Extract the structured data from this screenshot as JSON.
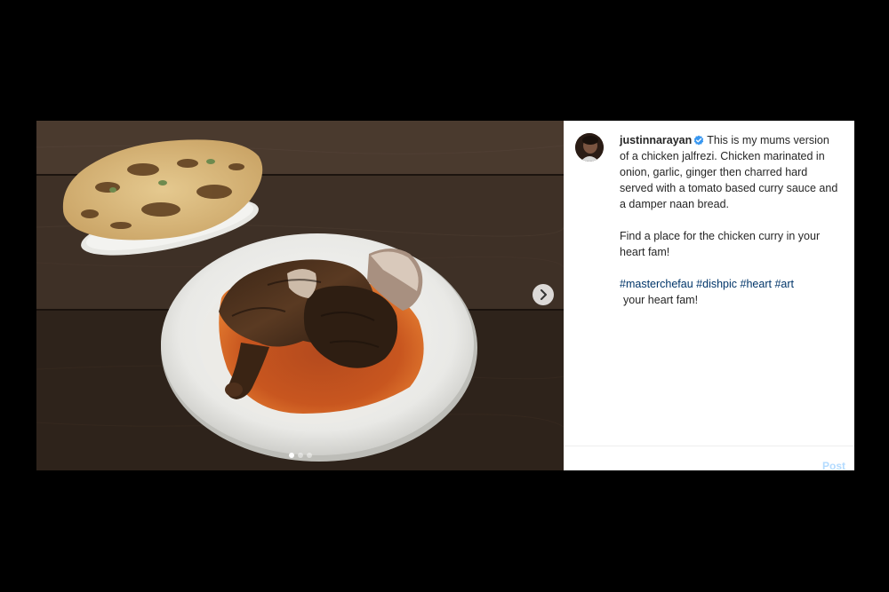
{
  "post": {
    "author": {
      "username": "justinnarayan",
      "verified": true
    },
    "caption": {
      "text": "This is my mums version of a chicken jalfrezi. Chicken marinated in onion, garlic, ginger then charred hard served with a tomato based curry sauce and a damper naan bread.",
      "second_paragraph": "Find a place for the chicken curry in your heart fam!",
      "hashtags": [
        "#masterchefau",
        "#dishpic",
        "#heart",
        "#art"
      ],
      "trailing_text": "your heart fam!"
    },
    "carousel": {
      "total_slides": 3,
      "current_slide": 1
    },
    "post_button_label": "Post",
    "icons": {
      "next": "chevron-right-icon",
      "verified": "verified-badge-icon"
    },
    "colors": {
      "hashtag": "#003569",
      "verified_badge": "#3897f0",
      "text": "#262626"
    }
  }
}
